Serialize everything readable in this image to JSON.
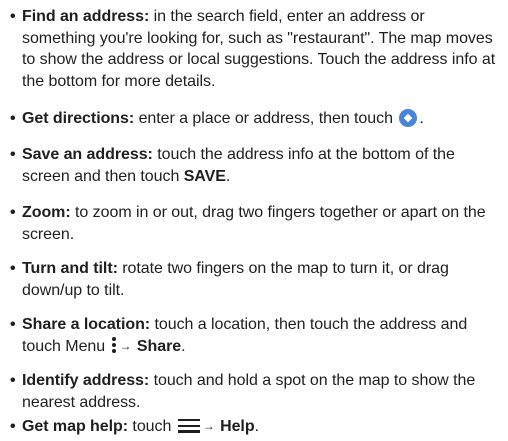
{
  "bullet": "•",
  "arrow": "→",
  "items": [
    {
      "title": "Find an address:",
      "text": " in the search field, enter an address or something you're looking for, such as \"restaurant\". The map moves to show the address or local suggestions. Touch the address info at the bottom for more details."
    },
    {
      "title": "Get directions:",
      "text": " enter a place or address, then touch ",
      "end": ".",
      "icon": "directions-icon",
      "icon_color": "#4a86d8"
    },
    {
      "title": "Save an address:",
      "text": " touch the address info at the bottom of the screen and then touch ",
      "bold": "SAVE",
      "end": "."
    },
    {
      "title": "Zoom:",
      "text": " to zoom in or out, drag two fingers together or apart on the screen."
    },
    {
      "title": "Turn and tilt:",
      "text": " rotate two fingers on the map to turn it, or drag down/up to tilt."
    },
    {
      "title": "Share a location:",
      "text": " touch a location, then touch the address and touch Menu ",
      "icon": "menu-more-icon",
      "bold": "Share",
      "end": "."
    },
    {
      "title": "Identify address:",
      "text": " touch and hold a spot on the map to show the nearest address."
    },
    {
      "title": "Get map help:",
      "text": " touch ",
      "icon": "hamburger-menu-icon",
      "bold": "Help",
      "end": "."
    }
  ]
}
